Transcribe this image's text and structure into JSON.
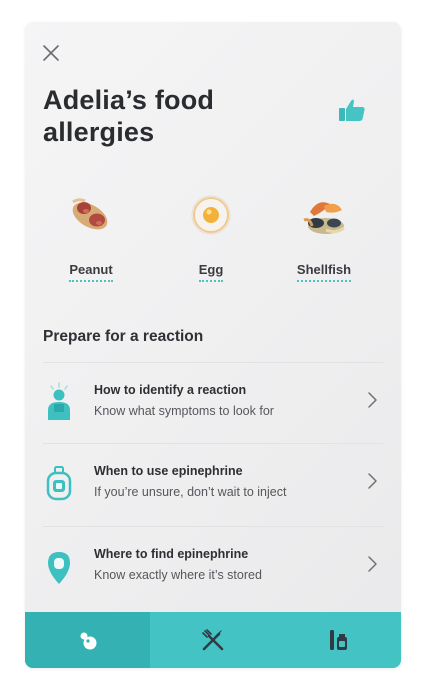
{
  "header": {
    "title": "Adelia’s food allergies",
    "close_icon": "close-icon",
    "like_icon": "thumbs-up-icon"
  },
  "allergens": [
    {
      "label": "Peanut",
      "icon": "peanut-icon"
    },
    {
      "label": "Egg",
      "icon": "egg-icon"
    },
    {
      "label": "Shellfish",
      "icon": "shellfish-icon"
    }
  ],
  "prepare": {
    "title": "Prepare for a reaction",
    "items": [
      {
        "title": "How to identify a reaction",
        "subtitle": "Know what symptoms to look for",
        "icon": "person-reaction-icon"
      },
      {
        "title": "When to use epinephrine",
        "subtitle": "If you’re unsure, don’t wait to inject",
        "icon": "epinephrine-icon"
      },
      {
        "title": "Where to find epinephrine",
        "subtitle": "Know exactly where it’s stored",
        "icon": "location-pin-icon"
      }
    ]
  },
  "tabbar": {
    "tabs": [
      {
        "icon": "allergens-tab-icon",
        "active": true
      },
      {
        "icon": "fork-knife-icon",
        "active": false
      },
      {
        "icon": "medicine-icon",
        "active": false
      }
    ]
  },
  "colors": {
    "accent": "#43c3c3",
    "accent_dark": "#34b1b2",
    "title_text": "#2a2c30"
  }
}
